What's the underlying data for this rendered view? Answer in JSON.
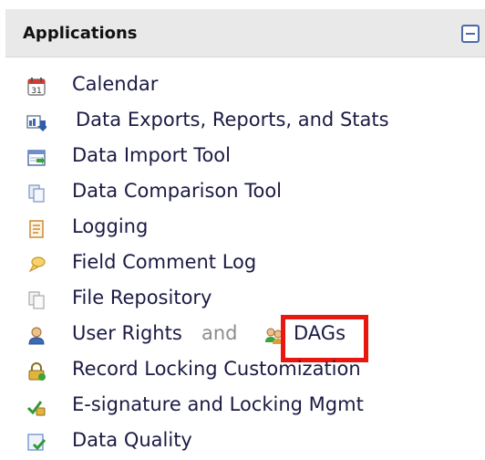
{
  "panel": {
    "title": "Applications",
    "collapse_icon": "minus-square-icon",
    "accent": "#4a6aa8"
  },
  "items": [
    {
      "label": "Calendar",
      "icon": "calendar-icon"
    },
    {
      "label": "Data Exports, Reports, and Stats",
      "icon": "data-export-icon"
    },
    {
      "label": "Data Import Tool",
      "icon": "data-import-icon"
    },
    {
      "label": "Data Comparison Tool",
      "icon": "document-compare-icon"
    },
    {
      "label": "Logging",
      "icon": "log-icon"
    },
    {
      "label": "Field Comment Log",
      "icon": "comment-balloon-icon"
    },
    {
      "label": "File Repository",
      "icon": "file-stack-icon"
    },
    {
      "label": "User Rights",
      "icon": "user-icon",
      "joiner": "and",
      "second_label": "DAGs",
      "second_icon": "user-group-icon"
    },
    {
      "label": "Record Locking Customization",
      "icon": "lock-icon"
    },
    {
      "label": "E-signature and Locking Mgmt",
      "icon": "signature-check-icon"
    },
    {
      "label": "Data Quality",
      "icon": "data-quality-icon"
    }
  ],
  "highlight": {
    "target": "DAGs",
    "color": "#e8170f"
  }
}
